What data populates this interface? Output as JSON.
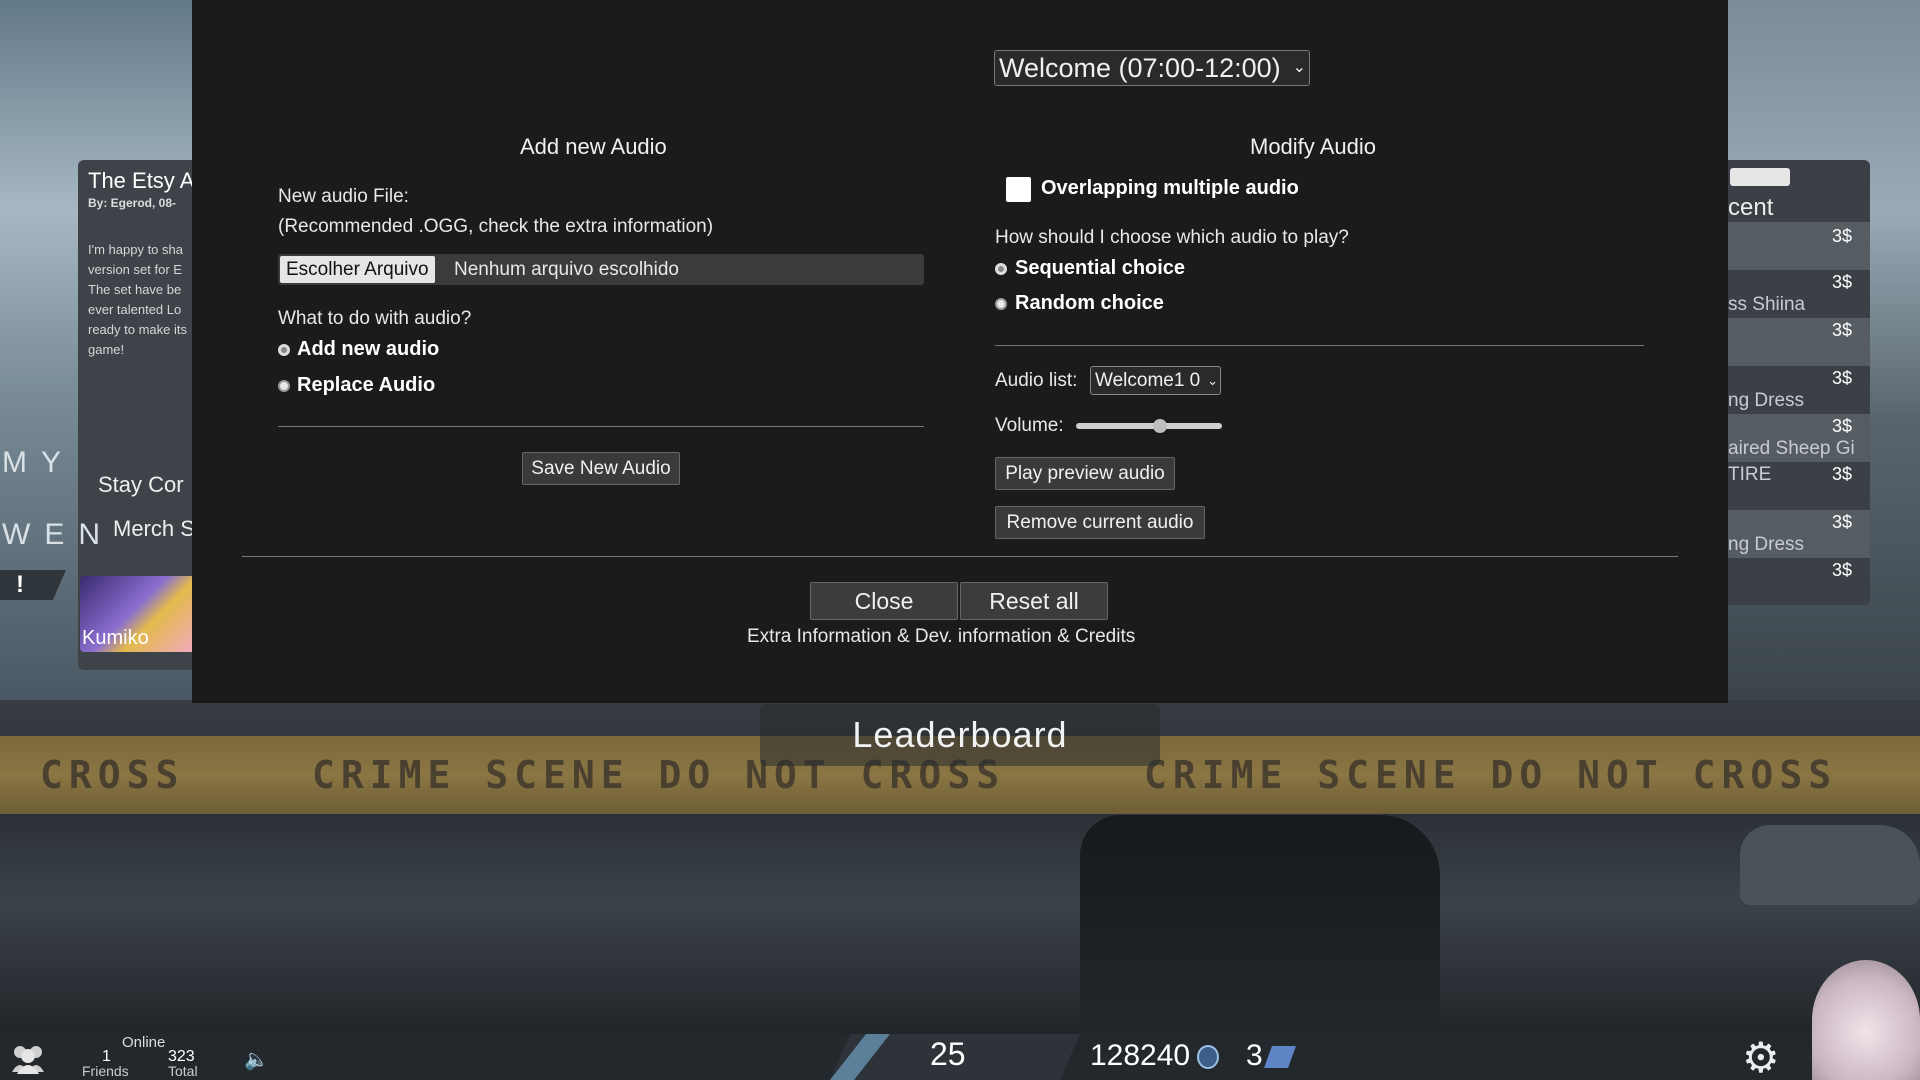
{
  "modal": {
    "time_select": "Welcome (07:00-12:00)",
    "add_section": {
      "title": "Add new Audio",
      "file_label": "New audio File:",
      "file_hint": "(Recommended .OGG, check the extra information)",
      "file_button": "Escolher Arquivo",
      "file_status": "Nenhum arquivo escolhido",
      "action_question": "What to do with audio?",
      "options": [
        "Add new audio",
        "Replace Audio"
      ],
      "selected_option": "Add new audio",
      "save_button": "Save New Audio"
    },
    "modify_section": {
      "title": "Modify Audio",
      "overlap_label": "Overlapping multiple audio",
      "overlap_checked": false,
      "choose_question": "How should I choose which audio to play?",
      "choices": [
        "Sequential choice",
        "Random choice"
      ],
      "selected_choice": "Sequential choice",
      "audio_list_label": "Audio list:",
      "audio_list_value": "Welcome1 0",
      "volume_label": "Volume:",
      "volume_level": 0.58,
      "play_button": "Play preview audio",
      "remove_button": "Remove current audio"
    },
    "close_button": "Close",
    "reset_button": "Reset all",
    "extra_link": "Extra Information & Dev. information & Credits"
  },
  "background": {
    "leaderboard": "Leaderboard",
    "tape_text": [
      "CROSS",
      "CRIME SCENE DO NOT CROSS",
      "CRIME SCENE DO NOT CROSS"
    ],
    "news": {
      "title": "The Etsy A",
      "byline": "By: Egerod, 08-",
      "body": [
        "I'm happy to sha",
        "version set for E",
        "The set have be",
        "ever talented Lo",
        "ready to make its",
        "game!"
      ]
    },
    "side_links": [
      "Stay Cor",
      "Merch S"
    ],
    "logo_lines": [
      "MY",
      "WEN"
    ],
    "exclaim": "!",
    "kumiko_label": "Kumiko",
    "shop": {
      "title": "cent",
      "prices": [
        "3$",
        "3$",
        "3$",
        "3$",
        "3$",
        "3$",
        "3$",
        "3$"
      ],
      "items": [
        "ss Shiina",
        "ng Dress",
        "aired Sheep Gi",
        "TIRE",
        "ng Dress"
      ]
    }
  },
  "bottom_bar": {
    "online_label": "Online",
    "friends_count": "1",
    "friends_label": "Friends",
    "total_count": "323",
    "total_label": "Total",
    "level": "25",
    "coins": "128240",
    "tickets": "3",
    "icons": [
      "friends-icon",
      "speaker-icon",
      "coin-icon",
      "ticket-icon",
      "settings-gear-icon"
    ]
  }
}
